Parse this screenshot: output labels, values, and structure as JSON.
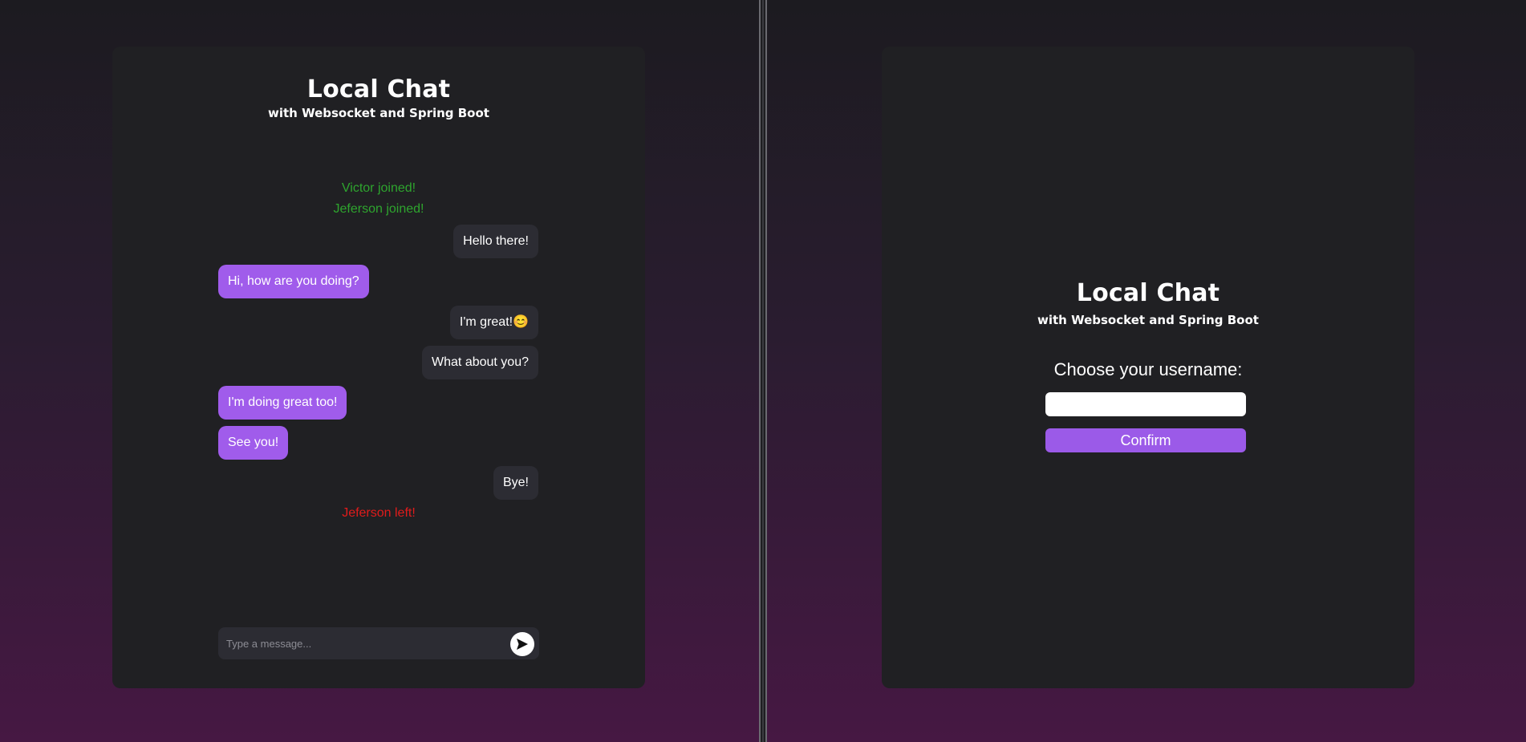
{
  "left_window": {
    "title": "Local Chat",
    "subtitle": "with Websocket and Spring Boot",
    "notices": {
      "victor_joined": "Victor joined!",
      "jeferson_joined": "Jeferson joined!",
      "jeferson_left": "Jeferson left!"
    },
    "messages": [
      {
        "side": "mine",
        "text": "Hello there!"
      },
      {
        "side": "theirs",
        "text": "Hi, how are you doing?"
      },
      {
        "side": "mine",
        "text": "I'm great!😊"
      },
      {
        "side": "mine",
        "text": "What about you?"
      },
      {
        "side": "theirs",
        "text": "I'm doing great too!"
      },
      {
        "side": "theirs",
        "text": "See you!"
      },
      {
        "side": "mine",
        "text": "Bye!"
      }
    ],
    "composer": {
      "placeholder": "Type a message...",
      "value": ""
    }
  },
  "right_window": {
    "title": "Local Chat",
    "subtitle": "with Websocket and Spring Boot",
    "prompt": "Choose your username:",
    "username_value": "",
    "confirm_label": "Confirm"
  },
  "colors": {
    "card_background": "#202023",
    "own_bubble": "#2c2c33",
    "other_bubble": "#a05ceb",
    "joined_notice": "#2ea52e",
    "left_notice": "#e01b1b",
    "confirm_button": "#9b5ae8"
  },
  "icons": {
    "send": "send-arrow-icon"
  }
}
